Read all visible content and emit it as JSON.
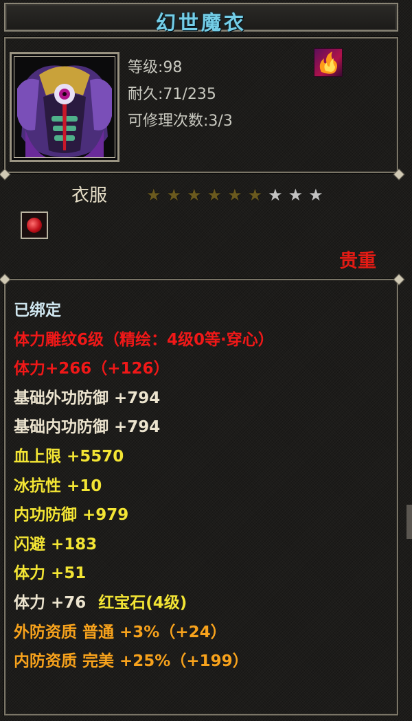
{
  "item_name": "幻世魔衣",
  "stats": {
    "level": "等级:98",
    "durability": "耐久:71/235",
    "repairs": "可修理次数:3/3"
  },
  "type_label": "衣服",
  "stars": {
    "filled": 6,
    "total": 9
  },
  "rarity": "贵重",
  "properties": [
    {
      "text": "已绑定",
      "color": "cyan"
    },
    {
      "text": "体力雕纹6级（精绘：4级0等·穿心）",
      "color": "red"
    },
    {
      "text": "体力+266（+126）",
      "color": "red"
    },
    {
      "text": "基础外功防御 +794",
      "color": "cream"
    },
    {
      "text": "基础内功防御 +794",
      "color": "cream"
    },
    {
      "text": "血上限 +5570",
      "color": "yellow"
    },
    {
      "text": "冰抗性 +10",
      "color": "yellow"
    },
    {
      "text": "内功防御 +979",
      "color": "yellow"
    },
    {
      "text": "闪避 +183",
      "color": "yellow"
    },
    {
      "text": "体力 +51",
      "color": "yellow"
    },
    {
      "text": "体力 +76",
      "color": "cream",
      "gem": "红宝石(4级)",
      "gem_color": "yellow"
    },
    {
      "text": "外防资质  普通 +3%（+24）",
      "color": "orange"
    },
    {
      "text": "内防资质  完美 +25%（+199）",
      "color": "orange"
    }
  ],
  "icons": {
    "portrait": "armor-robe-icon",
    "skill": "flame-skill-icon",
    "socket": "red-gem-socket-icon"
  }
}
